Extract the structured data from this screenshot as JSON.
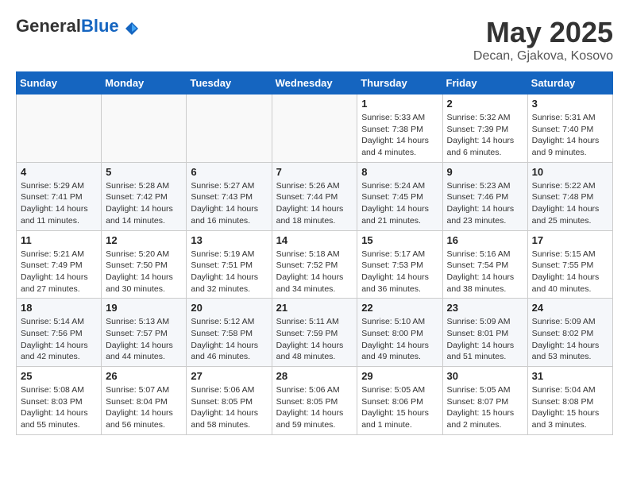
{
  "header": {
    "logo_general": "General",
    "logo_blue": "Blue",
    "month": "May 2025",
    "location": "Decan, Gjakova, Kosovo"
  },
  "days_of_week": [
    "Sunday",
    "Monday",
    "Tuesday",
    "Wednesday",
    "Thursday",
    "Friday",
    "Saturday"
  ],
  "weeks": [
    [
      {
        "day": "",
        "info": ""
      },
      {
        "day": "",
        "info": ""
      },
      {
        "day": "",
        "info": ""
      },
      {
        "day": "",
        "info": ""
      },
      {
        "day": "1",
        "info": "Sunrise: 5:33 AM\nSunset: 7:38 PM\nDaylight: 14 hours\nand 4 minutes."
      },
      {
        "day": "2",
        "info": "Sunrise: 5:32 AM\nSunset: 7:39 PM\nDaylight: 14 hours\nand 6 minutes."
      },
      {
        "day": "3",
        "info": "Sunrise: 5:31 AM\nSunset: 7:40 PM\nDaylight: 14 hours\nand 9 minutes."
      }
    ],
    [
      {
        "day": "4",
        "info": "Sunrise: 5:29 AM\nSunset: 7:41 PM\nDaylight: 14 hours\nand 11 minutes."
      },
      {
        "day": "5",
        "info": "Sunrise: 5:28 AM\nSunset: 7:42 PM\nDaylight: 14 hours\nand 14 minutes."
      },
      {
        "day": "6",
        "info": "Sunrise: 5:27 AM\nSunset: 7:43 PM\nDaylight: 14 hours\nand 16 minutes."
      },
      {
        "day": "7",
        "info": "Sunrise: 5:26 AM\nSunset: 7:44 PM\nDaylight: 14 hours\nand 18 minutes."
      },
      {
        "day": "8",
        "info": "Sunrise: 5:24 AM\nSunset: 7:45 PM\nDaylight: 14 hours\nand 21 minutes."
      },
      {
        "day": "9",
        "info": "Sunrise: 5:23 AM\nSunset: 7:46 PM\nDaylight: 14 hours\nand 23 minutes."
      },
      {
        "day": "10",
        "info": "Sunrise: 5:22 AM\nSunset: 7:48 PM\nDaylight: 14 hours\nand 25 minutes."
      }
    ],
    [
      {
        "day": "11",
        "info": "Sunrise: 5:21 AM\nSunset: 7:49 PM\nDaylight: 14 hours\nand 27 minutes."
      },
      {
        "day": "12",
        "info": "Sunrise: 5:20 AM\nSunset: 7:50 PM\nDaylight: 14 hours\nand 30 minutes."
      },
      {
        "day": "13",
        "info": "Sunrise: 5:19 AM\nSunset: 7:51 PM\nDaylight: 14 hours\nand 32 minutes."
      },
      {
        "day": "14",
        "info": "Sunrise: 5:18 AM\nSunset: 7:52 PM\nDaylight: 14 hours\nand 34 minutes."
      },
      {
        "day": "15",
        "info": "Sunrise: 5:17 AM\nSunset: 7:53 PM\nDaylight: 14 hours\nand 36 minutes."
      },
      {
        "day": "16",
        "info": "Sunrise: 5:16 AM\nSunset: 7:54 PM\nDaylight: 14 hours\nand 38 minutes."
      },
      {
        "day": "17",
        "info": "Sunrise: 5:15 AM\nSunset: 7:55 PM\nDaylight: 14 hours\nand 40 minutes."
      }
    ],
    [
      {
        "day": "18",
        "info": "Sunrise: 5:14 AM\nSunset: 7:56 PM\nDaylight: 14 hours\nand 42 minutes."
      },
      {
        "day": "19",
        "info": "Sunrise: 5:13 AM\nSunset: 7:57 PM\nDaylight: 14 hours\nand 44 minutes."
      },
      {
        "day": "20",
        "info": "Sunrise: 5:12 AM\nSunset: 7:58 PM\nDaylight: 14 hours\nand 46 minutes."
      },
      {
        "day": "21",
        "info": "Sunrise: 5:11 AM\nSunset: 7:59 PM\nDaylight: 14 hours\nand 48 minutes."
      },
      {
        "day": "22",
        "info": "Sunrise: 5:10 AM\nSunset: 8:00 PM\nDaylight: 14 hours\nand 49 minutes."
      },
      {
        "day": "23",
        "info": "Sunrise: 5:09 AM\nSunset: 8:01 PM\nDaylight: 14 hours\nand 51 minutes."
      },
      {
        "day": "24",
        "info": "Sunrise: 5:09 AM\nSunset: 8:02 PM\nDaylight: 14 hours\nand 53 minutes."
      }
    ],
    [
      {
        "day": "25",
        "info": "Sunrise: 5:08 AM\nSunset: 8:03 PM\nDaylight: 14 hours\nand 55 minutes."
      },
      {
        "day": "26",
        "info": "Sunrise: 5:07 AM\nSunset: 8:04 PM\nDaylight: 14 hours\nand 56 minutes."
      },
      {
        "day": "27",
        "info": "Sunrise: 5:06 AM\nSunset: 8:05 PM\nDaylight: 14 hours\nand 58 minutes."
      },
      {
        "day": "28",
        "info": "Sunrise: 5:06 AM\nSunset: 8:05 PM\nDaylight: 14 hours\nand 59 minutes."
      },
      {
        "day": "29",
        "info": "Sunrise: 5:05 AM\nSunset: 8:06 PM\nDaylight: 15 hours\nand 1 minute."
      },
      {
        "day": "30",
        "info": "Sunrise: 5:05 AM\nSunset: 8:07 PM\nDaylight: 15 hours\nand 2 minutes."
      },
      {
        "day": "31",
        "info": "Sunrise: 5:04 AM\nSunset: 8:08 PM\nDaylight: 15 hours\nand 3 minutes."
      }
    ]
  ]
}
